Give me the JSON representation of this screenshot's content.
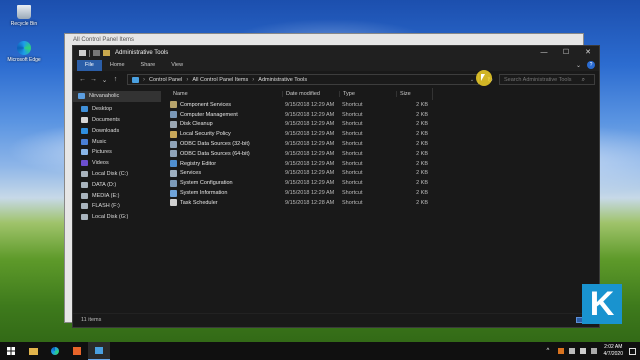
{
  "desktop": {
    "icons": [
      {
        "label": "Recycle Bin",
        "icon": "recycle-bin-icon"
      },
      {
        "label": "Microsoft Edge",
        "icon": "edge-icon"
      }
    ]
  },
  "back_window": {
    "title": "All Control Panel Items"
  },
  "window": {
    "title": "Administrative Tools",
    "controls": {
      "minimize": "—",
      "maximize": "☐",
      "close": "✕"
    },
    "ribbon_tabs": [
      {
        "label": "File",
        "active": true
      },
      {
        "label": "Home",
        "active": false
      },
      {
        "label": "Share",
        "active": false
      },
      {
        "label": "View",
        "active": false
      }
    ],
    "nav_buttons": {
      "back": "←",
      "forward": "→",
      "recent": "⌄",
      "up": "↑"
    },
    "breadcrumb": [
      "Control Panel",
      "All Control Panel Items",
      "Administrative Tools"
    ],
    "search": {
      "placeholder": "Search Administrative Tools"
    },
    "nav_pane": [
      {
        "label": "Nirvanaholic",
        "icon": "user-folder-icon",
        "color": "#5c9ee0"
      },
      {
        "label": "Desktop",
        "icon": "desktop-icon",
        "color": "#3f8fd8"
      },
      {
        "label": "Documents",
        "icon": "documents-icon",
        "color": "#d6d6d6"
      },
      {
        "label": "Downloads",
        "icon": "downloads-icon",
        "color": "#2f8fe0"
      },
      {
        "label": "Music",
        "icon": "music-icon",
        "color": "#4a7fd6"
      },
      {
        "label": "Pictures",
        "icon": "pictures-icon",
        "color": "#8ab6e8"
      },
      {
        "label": "Videos",
        "icon": "videos-icon",
        "color": "#6d4fcf"
      },
      {
        "label": "Local Disk (C:)",
        "icon": "drive-icon",
        "color": "#a9b4be"
      },
      {
        "label": "DATA (D:)",
        "icon": "drive-icon",
        "color": "#a9b4be"
      },
      {
        "label": "MEDIA (E:)",
        "icon": "drive-icon",
        "color": "#a9b4be"
      },
      {
        "label": "FLASH (F:)",
        "icon": "drive-icon",
        "color": "#a9b4be"
      },
      {
        "label": "Local Disk (G:)",
        "icon": "drive-icon",
        "color": "#a9b4be"
      }
    ],
    "columns": {
      "name": "Name",
      "date": "Date modified",
      "type": "Type",
      "size": "Size"
    },
    "files": [
      {
        "name": "Component Services",
        "date": "9/15/2018 12:29 AM",
        "type": "Shortcut",
        "size": "2 KB",
        "icon": "component-services-icon",
        "color": "#b7a36a"
      },
      {
        "name": "Computer Management",
        "date": "9/15/2018 12:29 AM",
        "type": "Shortcut",
        "size": "2 KB",
        "icon": "computer-management-icon",
        "color": "#7a98b8"
      },
      {
        "name": "Disk Cleanup",
        "date": "9/15/2018 12:29 AM",
        "type": "Shortcut",
        "size": "2 KB",
        "icon": "disk-cleanup-icon",
        "color": "#9aa7b3"
      },
      {
        "name": "Local Security Policy",
        "date": "9/15/2018 12:29 AM",
        "type": "Shortcut",
        "size": "2 KB",
        "icon": "security-policy-icon",
        "color": "#c9a85a"
      },
      {
        "name": "ODBC Data Sources (32-bit)",
        "date": "9/15/2018 12:29 AM",
        "type": "Shortcut",
        "size": "2 KB",
        "icon": "odbc-icon",
        "color": "#8fa3b8"
      },
      {
        "name": "ODBC Data Sources (64-bit)",
        "date": "9/15/2018 12:29 AM",
        "type": "Shortcut",
        "size": "2 KB",
        "icon": "odbc-icon",
        "color": "#8fa3b8"
      },
      {
        "name": "Registry Editor",
        "date": "9/15/2018 12:29 AM",
        "type": "Shortcut",
        "size": "2 KB",
        "icon": "registry-editor-icon",
        "color": "#4f8fd0"
      },
      {
        "name": "Services",
        "date": "9/15/2018 12:29 AM",
        "type": "Shortcut",
        "size": "2 KB",
        "icon": "services-icon",
        "color": "#9fb0c0"
      },
      {
        "name": "System Configuration",
        "date": "9/15/2018 12:29 AM",
        "type": "Shortcut",
        "size": "2 KB",
        "icon": "system-configuration-icon",
        "color": "#7c9ab8"
      },
      {
        "name": "System Information",
        "date": "9/15/2018 12:29 AM",
        "type": "Shortcut",
        "size": "2 KB",
        "icon": "system-information-icon",
        "color": "#6fa3d8"
      },
      {
        "name": "Task Scheduler",
        "date": "9/15/2018 12:28 AM",
        "type": "Shortcut",
        "size": "2 KB",
        "icon": "task-scheduler-icon",
        "color": "#d0d0d0"
      }
    ],
    "status": "11 items"
  },
  "logo": {
    "letter": "K"
  },
  "taskbar": {
    "clock_time": "2:02 AM",
    "clock_date": "4/7/2020"
  },
  "colors": {
    "accent": "#2b5ea8",
    "window_bg": "#191919"
  }
}
